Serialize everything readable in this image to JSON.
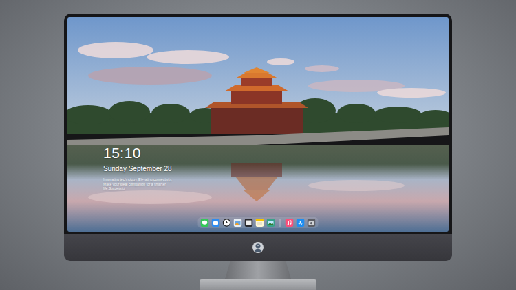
{
  "lock_screen": {
    "time": "15:10",
    "date": "Sunday September 28",
    "tagline": "Innovating technology, Elevating connectivity. Make your ideal companion for a smarter life.Successful"
  }
}
